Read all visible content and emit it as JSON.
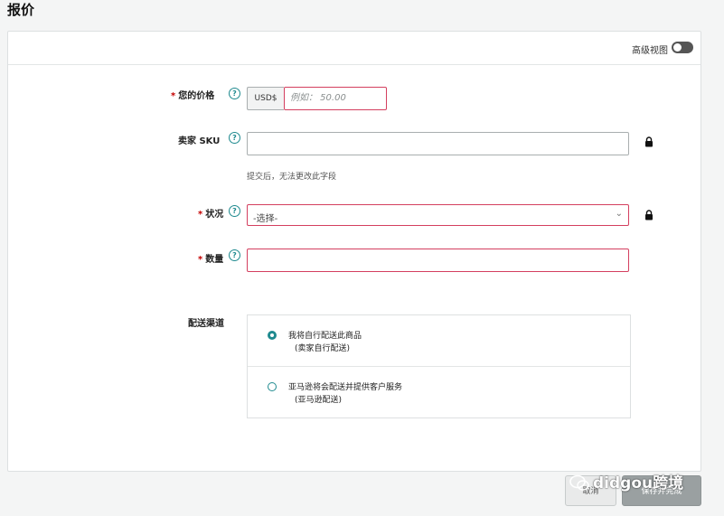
{
  "page": {
    "title": "报价"
  },
  "header": {
    "advanced_view_label": "高级视图",
    "advanced_view_on": false
  },
  "form": {
    "price": {
      "required_mark": "*",
      "label": "您的价格",
      "currency": "USD$",
      "placeholder": "例如： 50.00"
    },
    "sku": {
      "label": "卖家 SKU",
      "value": "",
      "hint": "提交后，无法更改此字段"
    },
    "condition": {
      "required_mark": "*",
      "label": "状况",
      "selected": "-选择-"
    },
    "quantity": {
      "required_mark": "*",
      "label": "数量",
      "value": ""
    },
    "shipping": {
      "label": "配送渠道",
      "options": [
        {
          "title": "我将自行配送此商品",
          "subtitle": "(卖家自行配送)",
          "selected": true
        },
        {
          "title": "亚马逊将会配送并提供客户服务",
          "subtitle": "(亚马逊配送)",
          "selected": false
        }
      ]
    }
  },
  "footer": {
    "cancel_label": "取消",
    "save_label": "保存并完成"
  },
  "watermark": {
    "text": "didgou跨境"
  },
  "colors": {
    "accent": "#1f8a8f",
    "error_border": "#d43f5f",
    "required": "#c40000"
  }
}
